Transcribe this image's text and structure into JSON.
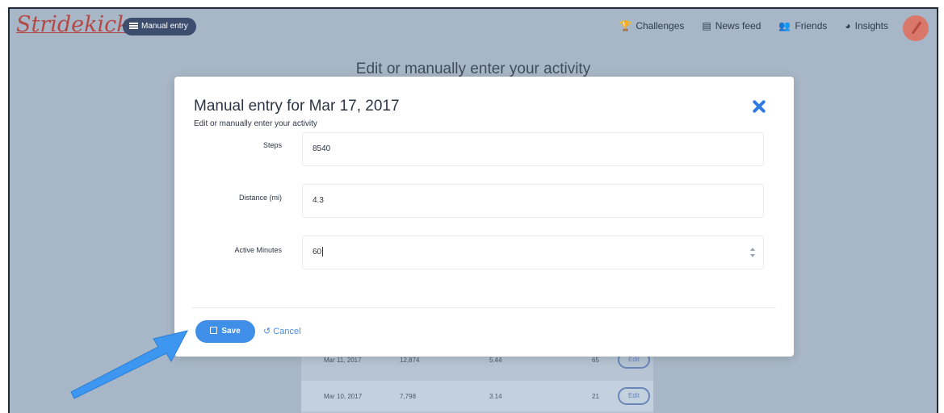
{
  "nav": {
    "logo": "Stridekick",
    "manual_entry_label": "Manual entry",
    "links": [
      {
        "icon": "trophy-icon",
        "glyph": "🏆",
        "label": "Challenges"
      },
      {
        "icon": "newspaper-icon",
        "glyph": "▤",
        "label": "News feed"
      },
      {
        "icon": "friends-icon",
        "glyph": "👥",
        "label": "Friends"
      },
      {
        "icon": "pie-chart-icon",
        "glyph": "◕",
        "label": "Insights"
      }
    ]
  },
  "page": {
    "heading": "Edit or manually enter your activity"
  },
  "background_table": {
    "rows": [
      {
        "date": "Mar 11, 2017",
        "steps": "12,874",
        "distance": "5.44",
        "minutes": "65",
        "edit": "Edit"
      },
      {
        "date": "Mar 10, 2017",
        "steps": "7,798",
        "distance": "3.14",
        "minutes": "21",
        "edit": "Edit"
      }
    ]
  },
  "modal": {
    "title": "Manual entry for Mar 17, 2017",
    "subtitle": "Edit or manually enter your activity",
    "fields": [
      {
        "label": "Steps",
        "value": "8540"
      },
      {
        "label": "Distance (mi)",
        "value": "4.3"
      },
      {
        "label": "Active Minutes",
        "value": "60"
      }
    ],
    "save_label": "Save",
    "cancel_label": "Cancel"
  },
  "colors": {
    "accent": "#3f8ee8",
    "overlay": "#a8b7c7",
    "logo": "#b34a46"
  }
}
